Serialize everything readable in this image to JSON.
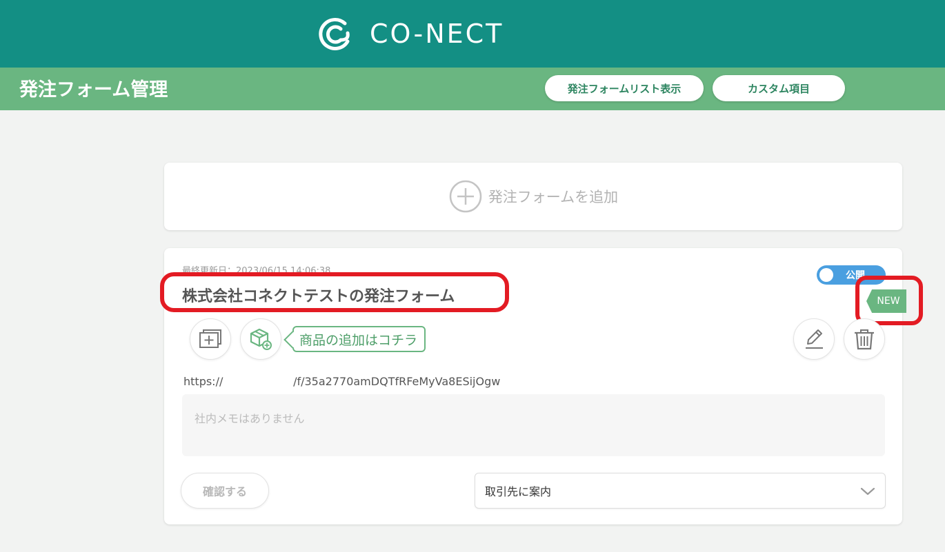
{
  "brand": {
    "name": "CO-NECT",
    "logo_icon": "conect-logo-icon"
  },
  "header": {
    "title": "発注フォーム管理",
    "list_button": "発注フォームリスト表示",
    "custom_button": "カスタム項目"
  },
  "add_card": {
    "label": "発注フォームを追加",
    "icon": "plus-circle-icon"
  },
  "form_card": {
    "updated": "最終更新日：2023/06/15 14:06:38",
    "title": "株式会社コネクトテストの発注フォーム",
    "toggle_label": "公開",
    "new_badge": "NEW",
    "callout": "商品の追加はコチラ",
    "url": "https://                    /f/35a2770amDQTfRFeMyVa8ESijOgw",
    "memo_placeholder": "社内メモはありません",
    "confirm_button": "確認する",
    "select_value": "取引先に案内"
  },
  "colors": {
    "topbar": "#138f84",
    "subbar": "#6ab681",
    "highlight": "#e31b23",
    "toggle": "#4a9fe0"
  }
}
